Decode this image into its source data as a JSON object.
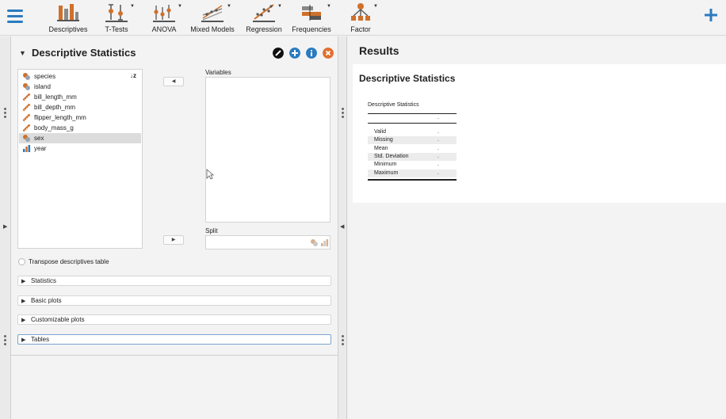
{
  "toolbar": {
    "menu_icon": "hamburger-menu-icon",
    "add_icon": "plus-icon",
    "items": [
      {
        "label": "Descriptives",
        "icon": "descriptives-bar-icon"
      },
      {
        "label": "T-Tests",
        "icon": "t-tests-icon"
      },
      {
        "label": "ANOVA",
        "icon": "anova-icon"
      },
      {
        "label": "Mixed Models",
        "icon": "mixed-models-icon"
      },
      {
        "label": "Regression",
        "icon": "regression-icon"
      },
      {
        "label": "Frequencies",
        "icon": "frequencies-icon"
      },
      {
        "label": "Factor",
        "icon": "factor-icon"
      }
    ]
  },
  "analysis": {
    "title": "Descriptive Statistics",
    "variables": [
      {
        "name": "species",
        "type": "nominal"
      },
      {
        "name": "island",
        "type": "nominal"
      },
      {
        "name": "bill_length_mm",
        "type": "scale"
      },
      {
        "name": "bill_depth_mm",
        "type": "scale"
      },
      {
        "name": "flipper_length_mm",
        "type": "scale"
      },
      {
        "name": "body_mass_g",
        "type": "scale"
      },
      {
        "name": "sex",
        "type": "nominal",
        "selected": true
      },
      {
        "name": "year",
        "type": "ordinal"
      }
    ],
    "variables_label": "Variables",
    "split_label": "Split",
    "transpose_label": "Transpose descriptives table",
    "sections": [
      "Statistics",
      "Basic plots",
      "Customizable plots",
      "Tables"
    ],
    "sort_label": "↓z"
  },
  "results": {
    "header": "Results",
    "card_title": "Descriptive Statistics",
    "table": {
      "caption": "Descriptive Statistics",
      "header_value": ".",
      "rows": [
        {
          "label": "Valid",
          "value": "."
        },
        {
          "label": "Missing",
          "value": "."
        },
        {
          "label": "Mean",
          "value": "."
        },
        {
          "label": "Std. Deviation",
          "value": "."
        },
        {
          "label": "Minimum",
          "value": "."
        },
        {
          "label": "Maximum",
          "value": "."
        }
      ]
    }
  },
  "colors": {
    "accent": "#2a7bbf",
    "icon_orange": "#d0702a",
    "close_orange": "#e07030"
  }
}
